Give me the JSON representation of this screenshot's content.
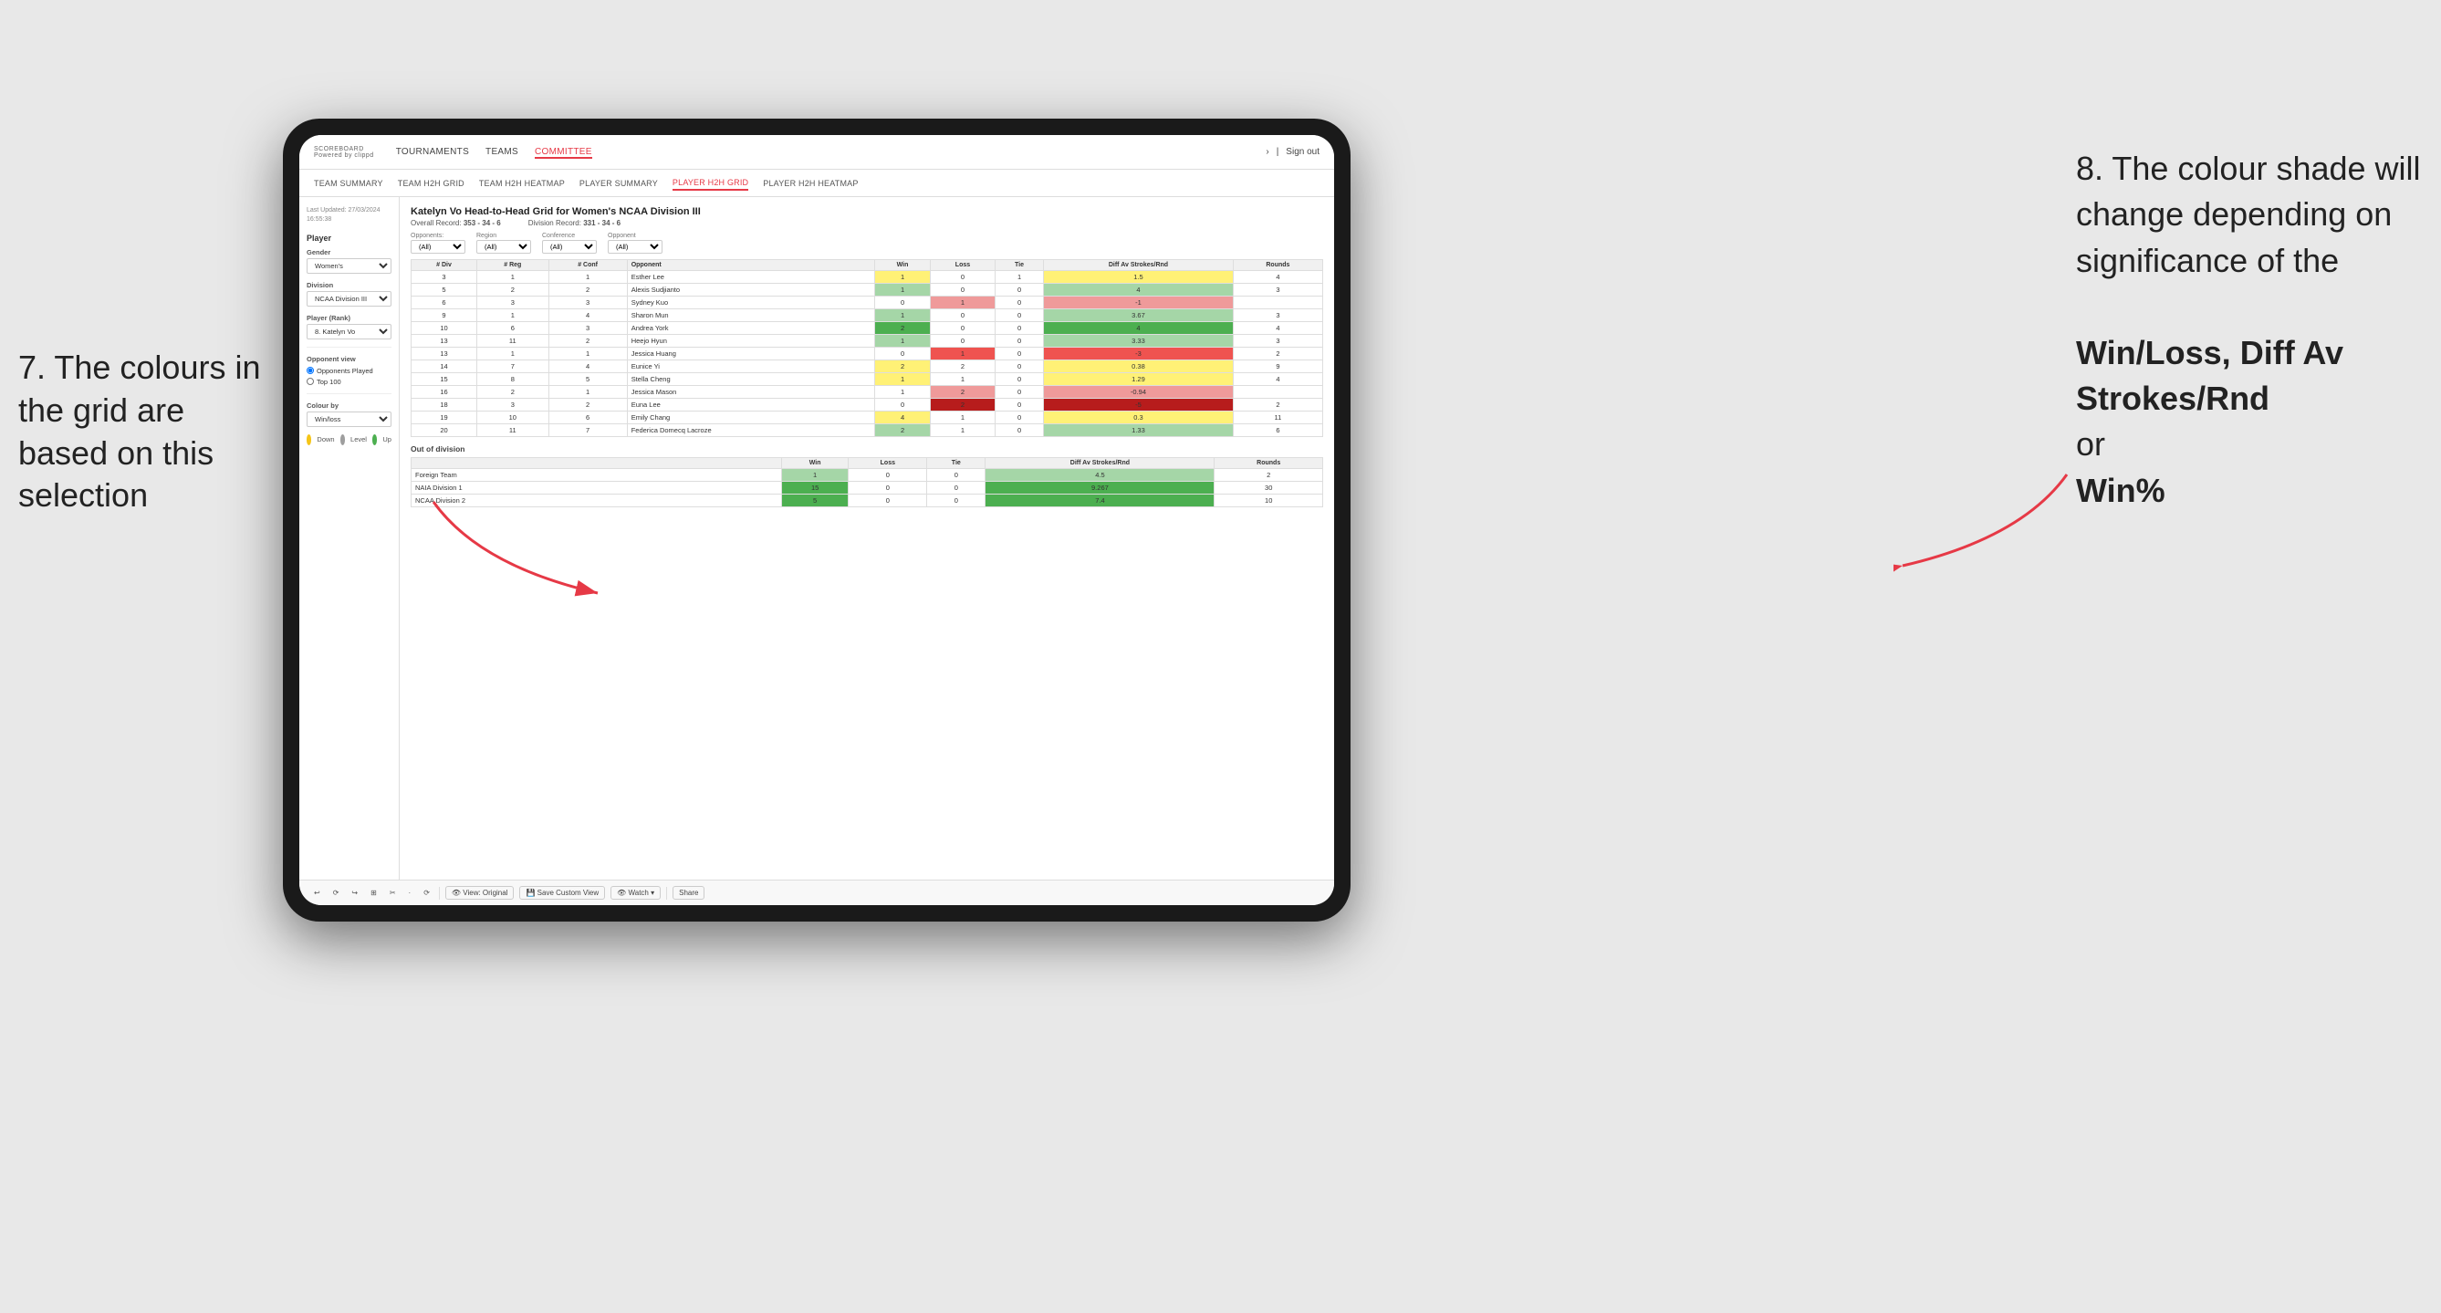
{
  "annotations": {
    "left_title": "7. The colours in the grid are based on this selection",
    "right_title": "8. The colour shade will change depending on significance of the",
    "right_bold1": "Win/Loss,",
    "right_bold2": "Diff Av Strokes/Rnd",
    "right_or": "or",
    "right_bold3": "Win%"
  },
  "nav": {
    "logo": "SCOREBOARD",
    "logo_sub": "Powered by clippd",
    "links": [
      "TOURNAMENTS",
      "TEAMS",
      "COMMITTEE"
    ],
    "active_link": "COMMITTEE",
    "right_items": [
      "Sign out"
    ]
  },
  "sub_nav": {
    "links": [
      "TEAM SUMMARY",
      "TEAM H2H GRID",
      "TEAM H2H HEATMAP",
      "PLAYER SUMMARY",
      "PLAYER H2H GRID",
      "PLAYER H2H HEATMAP"
    ],
    "active": "PLAYER H2H GRID"
  },
  "sidebar": {
    "timestamp": "Last Updated: 27/03/2024\n16:55:38",
    "player_label": "Player",
    "gender_label": "Gender",
    "gender_value": "Women's",
    "division_label": "Division",
    "division_value": "NCAA Division III",
    "player_rank_label": "Player (Rank)",
    "player_rank_value": "8. Katelyn Vo",
    "opponent_view_label": "Opponent view",
    "opponent_played": "Opponents Played",
    "opponent_top100": "Top 100",
    "colour_by_label": "Colour by",
    "colour_by_value": "Win/loss",
    "legend": [
      {
        "color": "#f5c518",
        "label": "Down"
      },
      {
        "color": "#9e9e9e",
        "label": "Level"
      },
      {
        "color": "#4caf50",
        "label": "Up"
      }
    ]
  },
  "grid": {
    "title": "Katelyn Vo Head-to-Head Grid for Women's NCAA Division III",
    "overall_record_label": "Overall Record:",
    "overall_record": "353 - 34 - 6",
    "division_record_label": "Division Record:",
    "division_record": "331 - 34 - 6",
    "filter_opponents_label": "Opponents:",
    "filter_opponents": "(All)",
    "filter_region_label": "Region",
    "filter_conference_label": "Conference",
    "filter_opponent_label": "Opponent",
    "filter_region_value": "(All)",
    "filter_conference_value": "(All)",
    "filter_opponent_value": "(All)",
    "columns": [
      "# Div",
      "# Reg",
      "# Conf",
      "Opponent",
      "Win",
      "Loss",
      "Tie",
      "Diff Av Strokes/Rnd",
      "Rounds"
    ],
    "rows": [
      {
        "div": 3,
        "reg": 1,
        "conf": 1,
        "opponent": "Esther Lee",
        "win": 1,
        "loss": 0,
        "tie": 1,
        "diff": 1.5,
        "rounds": 4,
        "win_color": "yellow",
        "loss_color": "none"
      },
      {
        "div": 5,
        "reg": 2,
        "conf": 2,
        "opponent": "Alexis Sudjianto",
        "win": 1,
        "loss": 0,
        "tie": 0,
        "diff": 4.0,
        "rounds": 3,
        "win_color": "green-light",
        "loss_color": "none"
      },
      {
        "div": 6,
        "reg": 3,
        "conf": 3,
        "opponent": "Sydney Kuo",
        "win": 0,
        "loss": 1,
        "tie": 0,
        "diff": -1.0,
        "rounds": "",
        "win_color": "none",
        "loss_color": "light-red"
      },
      {
        "div": 9,
        "reg": 1,
        "conf": 4,
        "opponent": "Sharon Mun",
        "win": 1,
        "loss": 0,
        "tie": 0,
        "diff": 3.67,
        "rounds": 3,
        "win_color": "green-light",
        "loss_color": "none"
      },
      {
        "div": 10,
        "reg": 6,
        "conf": 3,
        "opponent": "Andrea York",
        "win": 2,
        "loss": 0,
        "tie": 0,
        "diff": 4.0,
        "rounds": 4,
        "win_color": "green-dark",
        "loss_color": "none"
      },
      {
        "div": 13,
        "reg": 11,
        "conf": 2,
        "opponent": "Heejo Hyun",
        "win": 1,
        "loss": 0,
        "tie": 0,
        "diff": 3.33,
        "rounds": 3,
        "win_color": "green-light",
        "loss_color": "none"
      },
      {
        "div": 13,
        "reg": 1,
        "conf": 1,
        "opponent": "Jessica Huang",
        "win": 0,
        "loss": 1,
        "tie": 0,
        "diff": -3.0,
        "rounds": 2,
        "win_color": "none",
        "loss_color": "red"
      },
      {
        "div": 14,
        "reg": 7,
        "conf": 4,
        "opponent": "Eunice Yi",
        "win": 2,
        "loss": 2,
        "tie": 0,
        "diff": 0.38,
        "rounds": 9,
        "win_color": "yellow",
        "loss_color": "none"
      },
      {
        "div": 15,
        "reg": 8,
        "conf": 5,
        "opponent": "Stella Cheng",
        "win": 1,
        "loss": 1,
        "tie": 0,
        "diff": 1.29,
        "rounds": 4,
        "win_color": "yellow",
        "loss_color": "none"
      },
      {
        "div": 16,
        "reg": 2,
        "conf": 1,
        "opponent": "Jessica Mason",
        "win": 1,
        "loss": 2,
        "tie": 0,
        "diff": -0.94,
        "rounds": "",
        "win_color": "none",
        "loss_color": "light-red"
      },
      {
        "div": 18,
        "reg": 3,
        "conf": 2,
        "opponent": "Euna Lee",
        "win": 0,
        "loss": 2,
        "tie": 0,
        "diff": -5.0,
        "rounds": 2,
        "win_color": "none",
        "loss_color": "red-dark"
      },
      {
        "div": 19,
        "reg": 10,
        "conf": 6,
        "opponent": "Emily Chang",
        "win": 4,
        "loss": 1,
        "tie": 0,
        "diff": 0.3,
        "rounds": 11,
        "win_color": "yellow",
        "loss_color": "none"
      },
      {
        "div": 20,
        "reg": 11,
        "conf": 7,
        "opponent": "Federica Domecq Lacroze",
        "win": 2,
        "loss": 1,
        "tie": 0,
        "diff": 1.33,
        "rounds": 6,
        "win_color": "green-light",
        "loss_color": "none"
      }
    ],
    "out_of_division_label": "Out of division",
    "ood_columns": [
      "Opponent",
      "Win",
      "Loss",
      "Tie",
      "Diff Av Strokes/Rnd",
      "Rounds"
    ],
    "ood_rows": [
      {
        "opponent": "Foreign Team",
        "win": 1,
        "loss": 0,
        "tie": 0,
        "diff": 4.5,
        "rounds": 2,
        "win_color": "green-light"
      },
      {
        "opponent": "NAIA Division 1",
        "win": 15,
        "loss": 0,
        "tie": 0,
        "diff": 9.267,
        "rounds": 30,
        "win_color": "green-dark"
      },
      {
        "opponent": "NCAA Division 2",
        "win": 5,
        "loss": 0,
        "tie": 0,
        "diff": 7.4,
        "rounds": 10,
        "win_color": "green-dark"
      }
    ]
  },
  "toolbar": {
    "buttons": [
      "↩",
      "⟳",
      "↪",
      "⊞",
      "✂",
      "·",
      "⟳",
      "|",
      "👁 View: Original",
      "💾 Save Custom View",
      "👁 Watch ▾",
      "⊡",
      "⊞",
      "Share"
    ]
  }
}
